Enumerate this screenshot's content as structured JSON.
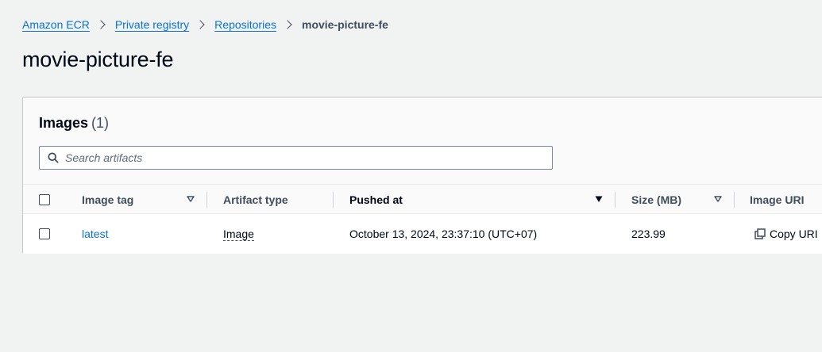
{
  "breadcrumb": {
    "items": [
      {
        "label": "Amazon ECR"
      },
      {
        "label": "Private registry"
      },
      {
        "label": "Repositories"
      }
    ],
    "current": "movie-picture-fe"
  },
  "page": {
    "title": "movie-picture-fe"
  },
  "images_panel": {
    "title": "Images",
    "count": "(1)",
    "search": {
      "placeholder": "Search artifacts",
      "value": ""
    },
    "columns": {
      "image_tag": "Image tag",
      "artifact_type": "Artifact type",
      "pushed_at": "Pushed at",
      "size": "Size (MB)",
      "image_uri": "Image URI"
    },
    "rows": [
      {
        "image_tag": "latest",
        "artifact_type": "Image",
        "pushed_at": "October 13, 2024, 23:37:10 (UTC+07)",
        "size": "223.99",
        "image_uri_action": "Copy URI"
      }
    ]
  },
  "colors": {
    "link": "#0972d3",
    "background": "#f1f2f2",
    "text": "#000716",
    "muted": "#414d5c"
  },
  "icons": {
    "breadcrumb_separator": "chevron-right-icon",
    "search": "search-icon",
    "sort_unsorted": "caret-down-outline-icon",
    "sort_active": "caret-down-filled-icon",
    "copy": "copy-icon"
  }
}
